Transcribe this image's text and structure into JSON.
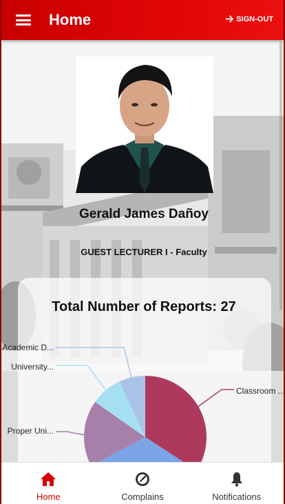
{
  "header": {
    "title": "Home",
    "signout_label": "SIGN-OUT"
  },
  "profile": {
    "name": "Gerald James Dañoy",
    "role": "GUEST LECTURER I - Faculty"
  },
  "reports": {
    "title": "Total Number of Reports: 27"
  },
  "chart_data": {
    "type": "pie",
    "title": "",
    "labels": [
      "Classroom ...",
      "Proper Uni...",
      "University...",
      "Academic D..."
    ],
    "values": [
      10,
      4,
      2,
      2
    ],
    "colors": [
      "#ad3a5c",
      "#a77fab",
      "#a5e0f2",
      "#a9c3e6"
    ],
    "note_hidden_slice_color": "#7ba4e6"
  },
  "nav": {
    "items": [
      {
        "label": "Home",
        "icon": "home-icon",
        "active": true
      },
      {
        "label": "Complains",
        "icon": "clock-icon",
        "active": false
      },
      {
        "label": "Notifications",
        "icon": "bell-icon",
        "active": false
      }
    ]
  },
  "colors": {
    "header": "#e10606",
    "active_nav": "#d60000"
  }
}
